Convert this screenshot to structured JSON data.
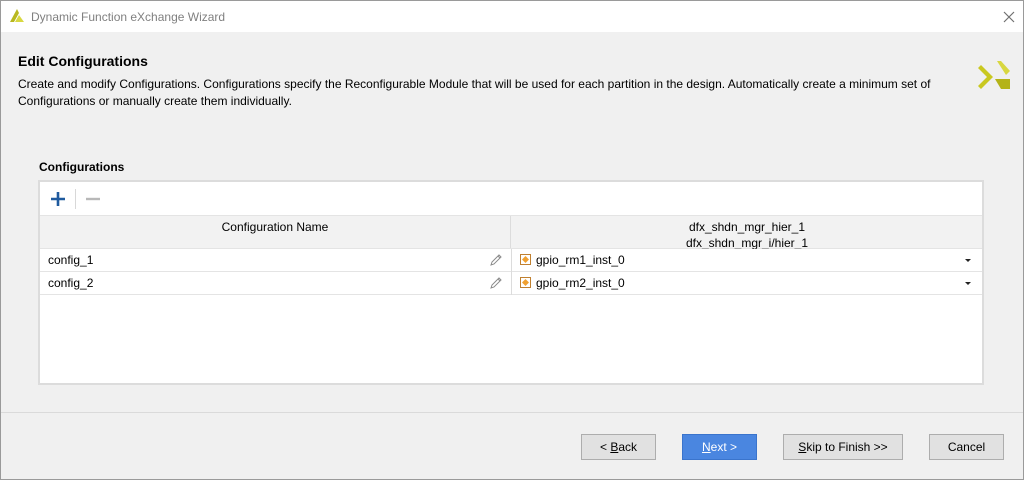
{
  "window": {
    "title": "Dynamic Function eXchange Wizard",
    "close_icon": "close-icon"
  },
  "header": {
    "heading": "Edit Configurations",
    "description": "Create and modify Configurations. Configurations specify the Reconfigurable Module that will be used for each partition in the design. Automatically create a minimum set of Configurations or manually create them individually."
  },
  "configurations": {
    "label": "Configurations",
    "toolbar": {
      "add_icon": "plus-icon",
      "remove_icon": "minus-icon"
    },
    "columns": {
      "name": "Configuration Name",
      "partition_line1": "dfx_shdn_mgr_hier_1",
      "partition_line2": "dfx_shdn_mgr_i/hier_1"
    },
    "rows": [
      {
        "name": "config_1",
        "module": "gpio_rm1_inst_0"
      },
      {
        "name": "config_2",
        "module": "gpio_rm2_inst_0"
      }
    ]
  },
  "buttons": {
    "back_prefix": "< ",
    "back_mnemonic": "B",
    "back_rest": "ack",
    "next_mnemonic": "N",
    "next_rest": "ext >",
    "skip_mnemonic": "S",
    "skip_rest": "kip to Finish >>",
    "cancel": "Cancel"
  },
  "colors": {
    "primary_button": "#4a86e0",
    "module_icon": "#f0a030",
    "logo": "#c9c820"
  }
}
